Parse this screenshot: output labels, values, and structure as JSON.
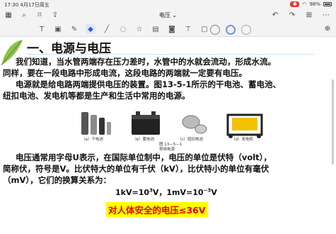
{
  "status": {
    "time": "17:30",
    "date": "4月17日周五",
    "battery": "98%"
  },
  "nav": {
    "title": "电压",
    "title_caret": "⌄"
  },
  "doc": {
    "heading": "一、电源与电压",
    "para1": "我们知道，当水管两端存在压力差时，水管中的水就会流动，形成水流。",
    "para2": "同样，要在一段电路中形成电流，这段电路的两端就一定要有电压。",
    "para3": "电源就是给电路两端提供电压的装置。图13-5-1所示的干电池、蓄电池、",
    "para4": "纽扣电池、发电机等都是生产和生活中常用的电源。",
    "figure": {
      "captions": [
        "（a）干电池",
        "（b）蓄电池",
        "（c）纽扣电池",
        "（d）发电机"
      ],
      "number": "图 13—5—1",
      "title": "常用电源"
    },
    "para5": "电压通常用字母U表示，在国际单位制中，电压的单位是伏特（volt），",
    "para6": "简称伏，符号是V。比伏特大的单位有千伏（kV），比伏特小的单位有毫伏",
    "para7": "（mV），它们的换算关系为：",
    "formula_a": "1kV=10",
    "formula_a_exp": "3",
    "formula_b": "V，1mV=10",
    "formula_b_exp": "−3",
    "formula_c": "V",
    "safety": "对人体安全的电压≤36V"
  },
  "colors": {
    "accent": "#e60000",
    "highlight": "#ffff00",
    "toolbar": "#f3f3f3"
  }
}
